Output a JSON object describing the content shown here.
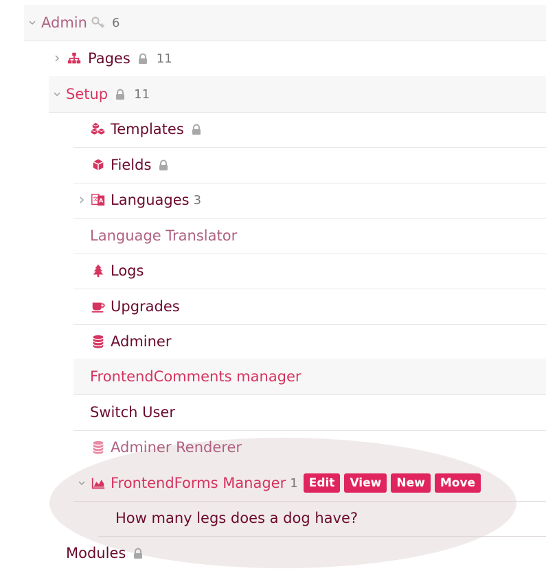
{
  "tree": {
    "admin": {
      "label": "Admin",
      "count": "6"
    },
    "pages": {
      "label": "Pages",
      "count": "11"
    },
    "setup": {
      "label": "Setup",
      "count": "11"
    },
    "templates": {
      "label": "Templates"
    },
    "fields": {
      "label": "Fields"
    },
    "languages": {
      "label": "Languages",
      "count": "3"
    },
    "language_translator": {
      "label": "Language Translator"
    },
    "logs": {
      "label": "Logs"
    },
    "upgrades": {
      "label": "Upgrades"
    },
    "adminer": {
      "label": "Adminer"
    },
    "frontend_comments": {
      "label": "FrontendComments manager"
    },
    "switch_user": {
      "label": "Switch User"
    },
    "adminer_renderer": {
      "label": "Adminer Renderer"
    },
    "frontendforms": {
      "label": "FrontendForms Manager",
      "count": "1",
      "actions": {
        "edit": "Edit",
        "view": "View",
        "new": "New",
        "move": "Move"
      }
    },
    "question": {
      "label": "How many legs does a dog have?"
    },
    "modules": {
      "label": "Modules"
    }
  },
  "icons": {
    "admin": "key-icon",
    "pages": "sitemap-icon",
    "templates": "cubes-icon",
    "fields": "cube-icon",
    "languages": "language-icon",
    "logs": "tree-icon",
    "upgrades": "coffee-icon",
    "adminer": "database-icon",
    "adminer_renderer": "database-icon",
    "frontendforms": "area-chart-icon",
    "locked": "lock-icon"
  },
  "colors": {
    "text": "#6b0a2e",
    "accent": "#e0245e",
    "muted_link": "#b06080",
    "row_shade": "#f7f7f8",
    "highlight": "#f0eaea"
  }
}
